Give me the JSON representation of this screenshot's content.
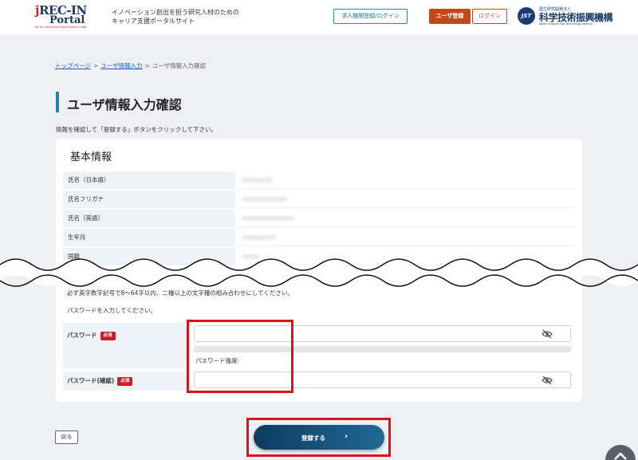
{
  "header": {
    "logo": {
      "line1_j": "j",
      "line1_rest": "REC-IN",
      "line2": "Portal",
      "sub": "for all researchers and research staff"
    },
    "tagline_line1": "イノベーション創出を担う研究人材のための",
    "tagline_line2": "キャリア支援ポータルサイト",
    "org_button": "求人機関登録/ログイン",
    "register_button": "ユーザ登録",
    "login_button": "ログイン",
    "jst": {
      "mark": "JST",
      "small": "国立研究開発法人",
      "name": "科学技術振興機構",
      "en": "Japan Science and Technology Agency"
    }
  },
  "breadcrumb": {
    "home": "トップページ",
    "sep": ">",
    "input": "ユーザ情報入力",
    "current": "ユーザ情報入力確認"
  },
  "page": {
    "title": "ユーザ情報入力確認",
    "instruction": "情報を確認して「登録する」ボタンをクリックして下さい。"
  },
  "basic_info": {
    "section_title": "基本情報",
    "rows": [
      {
        "label": "氏名（日本語）"
      },
      {
        "label": "氏名フリガナ"
      },
      {
        "label": "氏名（英語）"
      },
      {
        "label": "生年月"
      },
      {
        "label": "国籍"
      }
    ]
  },
  "password": {
    "note1": "必ず英字数字記号で8〜64字以内、二種以上の文字種の組み合わせにしてください。",
    "note2": "パスワードを入力してください。",
    "label": "パスワード",
    "confirm_label": "パスワード(確認)",
    "required": "必須",
    "strength_label": "パスワード強度:",
    "icon": "eye-slash-icon"
  },
  "footer": {
    "back": "戻る",
    "submit": "登録する",
    "submit_chevron": "›"
  },
  "colors": {
    "accent": "#2a7fa8",
    "brand_orange": "#c24a1a",
    "required_red": "#c8202a",
    "highlight_red": "#e0101a"
  }
}
